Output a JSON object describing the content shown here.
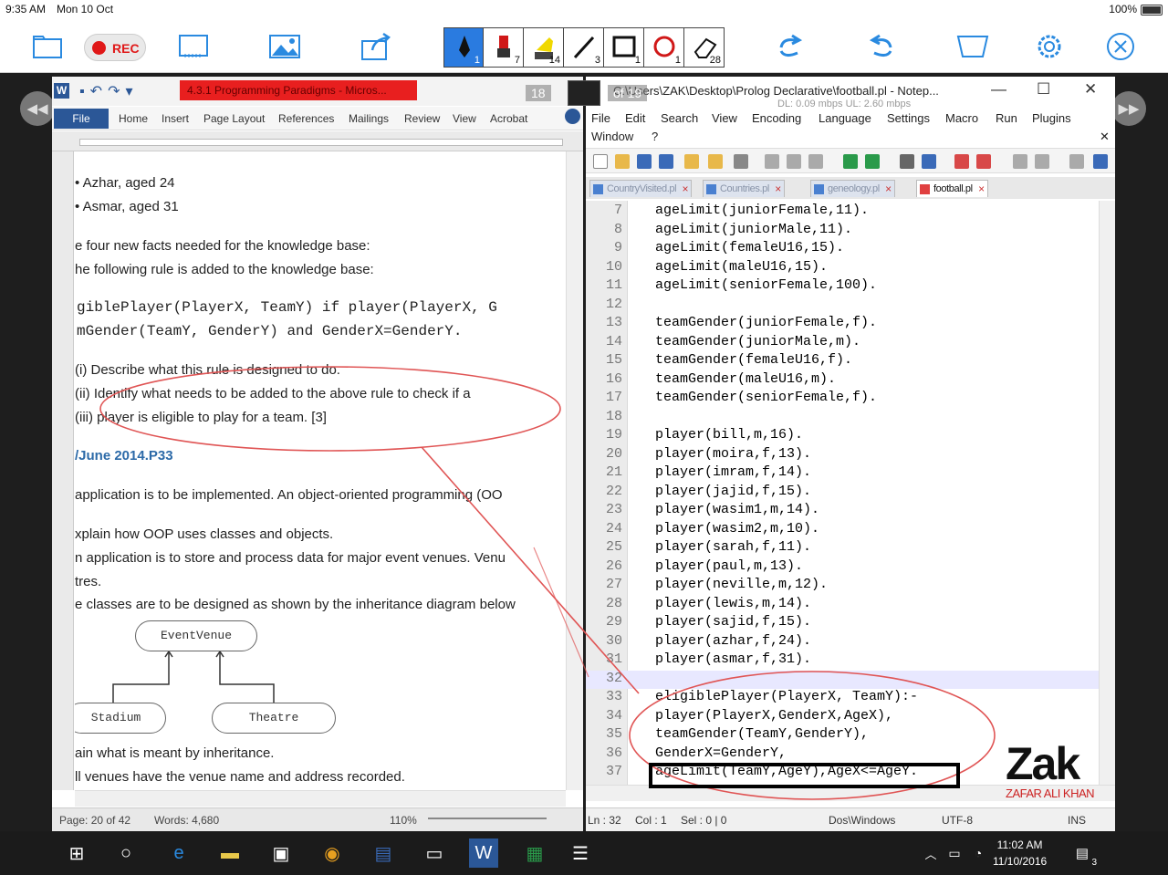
{
  "status_bar": {
    "time": "9:35 AM",
    "date": "Mon 10 Oct",
    "battery": "100%"
  },
  "annotation_toolbar": {
    "rec_label": "REC",
    "pens": [
      {
        "name": "pen",
        "size": "1"
      },
      {
        "name": "marker",
        "size": "7"
      },
      {
        "name": "highlighter",
        "size": "14"
      },
      {
        "name": "line",
        "size": "3"
      },
      {
        "name": "rectangle",
        "size": "1"
      },
      {
        "name": "ellipse",
        "size": "1"
      },
      {
        "name": "eraser",
        "size": "28"
      }
    ]
  },
  "page_overlay": {
    "current": "18",
    "total": "of 19"
  },
  "word": {
    "doc_title": "4.3.1 Programming Paradigms - Micros...",
    "tabs": [
      "File",
      "Home",
      "Insert",
      "Page Layout",
      "References",
      "Mailings",
      "Review",
      "View",
      "Acrobat"
    ],
    "lines": [
      "•     Azhar, aged 24",
      "•     Asmar, aged 31",
      "e four new facts needed for the knowledge base:",
      "he following rule is added to the knowledge base:",
      "giblePlayer(PlayerX, TeamY) if player(PlayerX, G",
      "mGender(TeamY, GenderY) and GenderX=GenderY.",
      "(i)        Describe what this rule is designed to do.",
      "(ii)       Identify what needs to be added to the above rule to check if a",
      "(iii)      player is eligible to play for a team.        [3]",
      "/June 2014.P33",
      " application is to be implemented. An object-oriented programming (OO",
      "xplain how OOP uses classes and objects.",
      "n application is to store and process data for major event venues. Venu",
      "tres.",
      "e classes are to be designed as shown by the inheritance diagram below",
      "ain what is meant by inheritance.",
      "ll venues have the venue name and address recorded."
    ],
    "diagram": {
      "parent": "EventVenue",
      "child1": "Stadium",
      "child2": "Theatre"
    },
    "status": {
      "page": "Page: 20 of 42",
      "words": "Words: 4,680",
      "zoom": "110%"
    }
  },
  "notepad": {
    "title": "C:\\Users\\ZAK\\Desktop\\Prolog Declarative\\football.pl - Notep...",
    "net_info": "DL: 0.09 mbps  UL: 2.60 mbps",
    "menu_row1": [
      "File",
      "Edit",
      "Search",
      "View",
      "Encoding",
      "Language",
      "Settings",
      "Macro",
      "Run",
      "Plugins"
    ],
    "menu_row2": [
      "Window",
      "?"
    ],
    "tabs": [
      "CountryVisited.pl",
      "Countries.pl",
      "geneology.pl",
      "football.pl"
    ],
    "code": [
      {
        "n": "7",
        "t": "ageLimit(juniorFemale,11)."
      },
      {
        "n": "8",
        "t": "ageLimit(juniorMale,11)."
      },
      {
        "n": "9",
        "t": "ageLimit(femaleU16,15)."
      },
      {
        "n": "10",
        "t": "ageLimit(maleU16,15)."
      },
      {
        "n": "11",
        "t": "ageLimit(seniorFemale,100)."
      },
      {
        "n": "12",
        "t": ""
      },
      {
        "n": "13",
        "t": "teamGender(juniorFemale,f)."
      },
      {
        "n": "14",
        "t": "teamGender(juniorMale,m)."
      },
      {
        "n": "15",
        "t": "teamGender(femaleU16,f)."
      },
      {
        "n": "16",
        "t": "teamGender(maleU16,m)."
      },
      {
        "n": "17",
        "t": "teamGender(seniorFemale,f)."
      },
      {
        "n": "18",
        "t": ""
      },
      {
        "n": "19",
        "t": "player(bill,m,16)."
      },
      {
        "n": "20",
        "t": "player(moira,f,13)."
      },
      {
        "n": "21",
        "t": "player(imram,f,14)."
      },
      {
        "n": "22",
        "t": "player(jajid,f,15)."
      },
      {
        "n": "23",
        "t": "player(wasim1,m,14)."
      },
      {
        "n": "24",
        "t": "player(wasim2,m,10)."
      },
      {
        "n": "25",
        "t": "player(sarah,f,11)."
      },
      {
        "n": "26",
        "t": "player(paul,m,13)."
      },
      {
        "n": "27",
        "t": "player(neville,m,12)."
      },
      {
        "n": "28",
        "t": "player(lewis,m,14)."
      },
      {
        "n": "29",
        "t": "player(sajid,f,15)."
      },
      {
        "n": "30",
        "t": "player(azhar,f,24)."
      },
      {
        "n": "31",
        "t": "player(asmar,f,31)."
      },
      {
        "n": "32",
        "t": ""
      },
      {
        "n": "33",
        "t": "eligiblePlayer(PlayerX, TeamY):-"
      },
      {
        "n": "34",
        "t": "player(PlayerX,GenderX,AgeX),"
      },
      {
        "n": "35",
        "t": "teamGender(TeamY,GenderY),"
      },
      {
        "n": "36",
        "t": "GenderX=GenderY,"
      },
      {
        "n": "37",
        "t": "ageLimit(TeamY,AgeY),AgeX<=AgeY."
      }
    ],
    "status": {
      "ln": "Ln : 32",
      "col": "Col : 1",
      "sel": "Sel : 0 | 0",
      "eol": "Dos\\Windows",
      "enc": "UTF-8",
      "ins": "INS"
    }
  },
  "watermark": {
    "brand": "Zak",
    "name": "ZAFAR ALI KHAN"
  },
  "taskbar": {
    "time": "11:02 AM",
    "date": "11/10/2016",
    "notifications": "3"
  },
  "colors": {
    "accent_blue": "#2a8ae0",
    "rec_red": "#e01818",
    "annotation_red": "#e05555"
  }
}
